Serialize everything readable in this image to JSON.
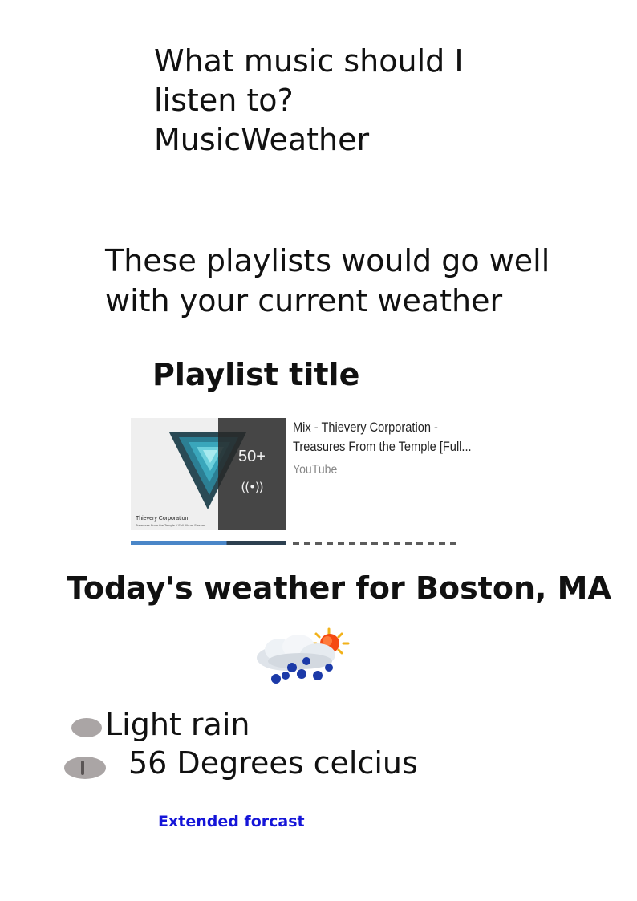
{
  "header": {
    "title_line1": "What music should I",
    "title_line2": "listen to?",
    "app_name": "MusicWeather"
  },
  "recommendation": {
    "intro": "These playlists would go well with your current weather",
    "playlist_heading": "Playlist title"
  },
  "playlist_card": {
    "video_title_line1": "Mix - Thievery Corporation -",
    "video_title_line2": "Treasures From the Temple [Full...",
    "source": "YouTube",
    "video_count": "50+",
    "live_icon": "((•))",
    "thumbnail_caption": "Thievery Corporation",
    "thumbnail_subcaption": "Treasures From the Temple // Full Album Stream",
    "thumbnail_icon": "triangle-logo-icon",
    "accent_color": "#3a9ab0"
  },
  "weather": {
    "heading": "Today's weather for Boston, MA",
    "icon": "rain-cloud-sun-icon",
    "condition": "Light rain",
    "temperature": "56 Degrees celcius",
    "extended_link": "Extended forcast",
    "link_color": "#1515d8"
  }
}
